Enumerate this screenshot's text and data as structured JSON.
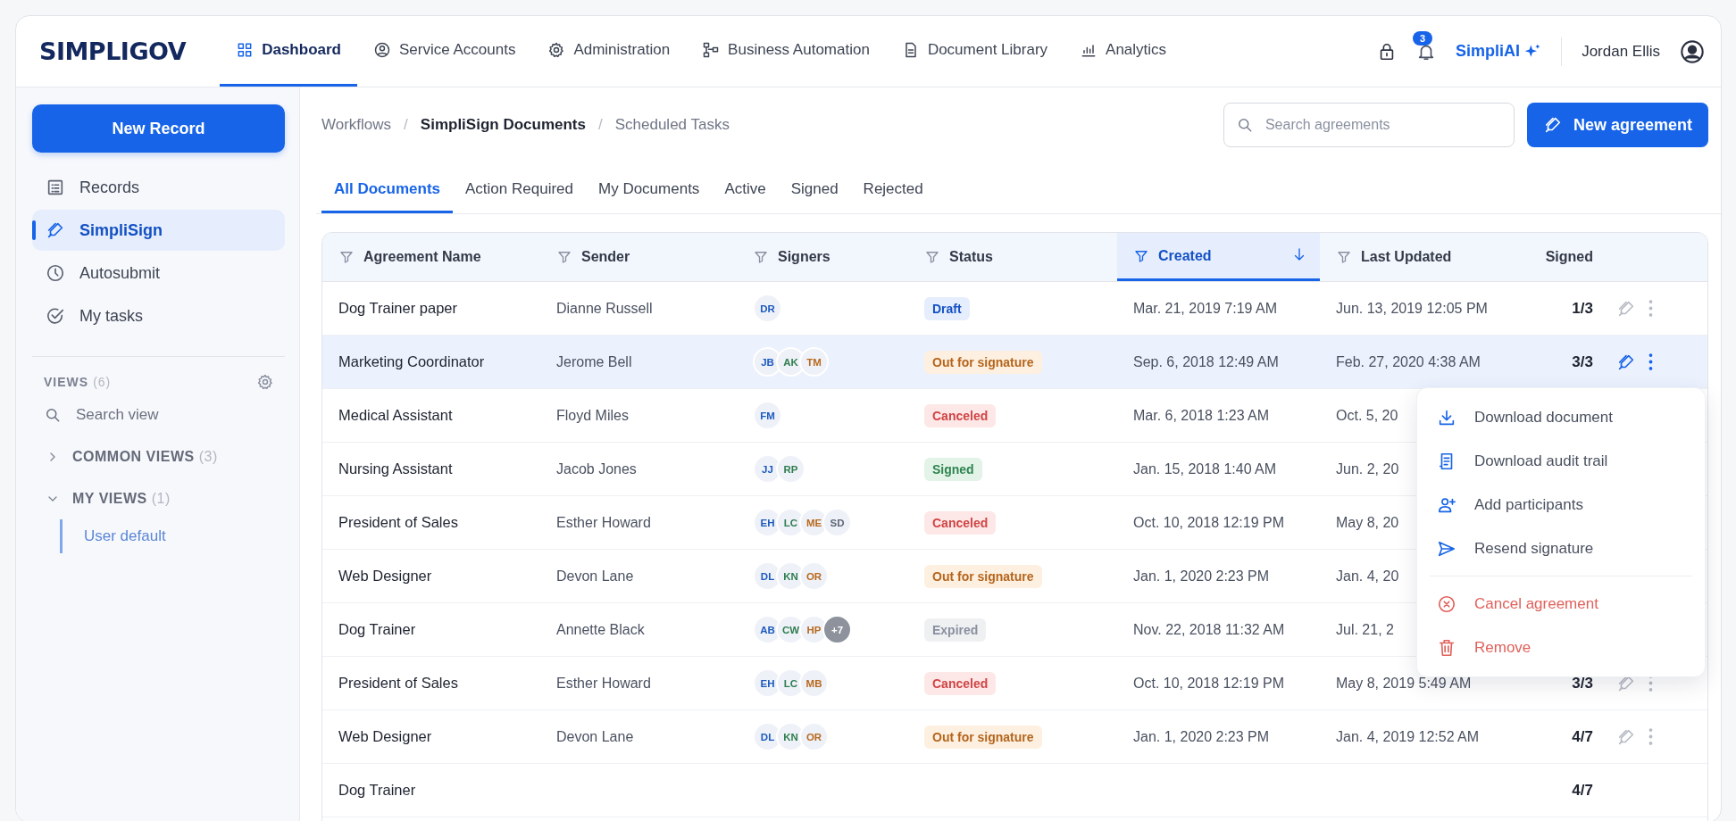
{
  "header": {
    "logo": "SIMPLIGOV",
    "nav": [
      {
        "label": "Dashboard",
        "selected": true
      },
      {
        "label": "Service Accounts",
        "selected": false
      },
      {
        "label": "Administration",
        "selected": false
      },
      {
        "label": "Business Automation",
        "selected": false
      },
      {
        "label": "Document Library",
        "selected": false
      },
      {
        "label": "Analytics",
        "selected": false
      }
    ],
    "notification_count": "3",
    "ai_label": "SimpliAI",
    "user_name": "Jordan Ellis"
  },
  "sidebar": {
    "new_button": "New Record",
    "items": [
      {
        "label": "Records",
        "selected": false
      },
      {
        "label": "SimpliSign",
        "selected": true
      },
      {
        "label": "Autosubmit",
        "selected": false
      },
      {
        "label": "My tasks",
        "selected": false
      }
    ],
    "views_title": "VIEWS",
    "views_count": "(6)",
    "search_placeholder": "Search view",
    "groups": [
      {
        "label": "COMMON VIEWS",
        "count": "(3)",
        "expanded": false
      },
      {
        "label": "MY VIEWS",
        "count": "(1)",
        "expanded": true,
        "children": [
          {
            "label": "User default"
          }
        ]
      }
    ]
  },
  "breadcrumb": {
    "separator": "/",
    "items": [
      {
        "label": "Workflows",
        "current": false
      },
      {
        "label": "SimpliSign Documents",
        "current": true
      },
      {
        "label": "Scheduled Tasks",
        "current": false
      }
    ]
  },
  "search": {
    "placeholder": "Search agreements"
  },
  "new_agreement_button": "New agreement",
  "tabs": [
    {
      "label": "All Documents",
      "selected": true
    },
    {
      "label": "Action Required",
      "selected": false
    },
    {
      "label": "My Documents",
      "selected": false
    },
    {
      "label": "Active",
      "selected": false
    },
    {
      "label": "Signed",
      "selected": false
    },
    {
      "label": "Rejected",
      "selected": false
    }
  ],
  "table": {
    "columns": [
      {
        "label": "Agreement Name",
        "filter": true,
        "sorted": false
      },
      {
        "label": "Sender",
        "filter": true,
        "sorted": false
      },
      {
        "label": "Signers",
        "filter": true,
        "sorted": false
      },
      {
        "label": "Status",
        "filter": true,
        "sorted": false
      },
      {
        "label": "Created",
        "filter": true,
        "sorted": true
      },
      {
        "label": "Last Updated",
        "filter": true,
        "sorted": false
      },
      {
        "label": "Signed",
        "filter": false,
        "sorted": false
      }
    ],
    "rows": [
      {
        "name": "Dog Trainer paper",
        "sender": "Dianne Russell",
        "signers": [
          {
            "initials": "DR",
            "color": "#1d5bbf"
          }
        ],
        "status": {
          "label": "Draft",
          "kind": "draft"
        },
        "created": "Mar. 21, 2019 7:19 AM",
        "updated": "Jun. 13, 2019 12:05 PM",
        "signed": "1/3",
        "actions": true,
        "selected": false
      },
      {
        "name": "Marketing Coordinator",
        "sender": "Jerome Bell",
        "signers": [
          {
            "initials": "JB",
            "color": "#1d5bbf"
          },
          {
            "initials": "AK",
            "color": "#2f7d4f"
          },
          {
            "initials": "TM",
            "color": "#b86a1e"
          }
        ],
        "status": {
          "label": "Out for signature",
          "kind": "pending"
        },
        "created": "Sep. 6, 2018 12:49 AM",
        "updated": "Feb. 27, 2020 4:38 AM",
        "signed": "3/3",
        "actions": true,
        "selected": true
      },
      {
        "name": "Medical Assistant",
        "sender": "Floyd Miles",
        "signers": [
          {
            "initials": "FM",
            "color": "#1d5bbf"
          }
        ],
        "status": {
          "label": "Canceled",
          "kind": "canceled"
        },
        "created": "Mar. 6, 2018 1:23 AM",
        "updated": "Oct. 5, 20",
        "actions": false,
        "selected": false
      },
      {
        "name": "Nursing Assistant",
        "sender": "Jacob Jones",
        "signers": [
          {
            "initials": "JJ",
            "color": "#1d5bbf"
          },
          {
            "initials": "RP",
            "color": "#2f7d4f"
          }
        ],
        "status": {
          "label": "Signed",
          "kind": "signed"
        },
        "created": "Jan. 15, 2018 1:40 AM",
        "updated": "Jun. 2, 20",
        "actions": false,
        "selected": false
      },
      {
        "name": "President of Sales",
        "sender": "Esther Howard",
        "signers": [
          {
            "initials": "EH",
            "color": "#1d5bbf"
          },
          {
            "initials": "LC",
            "color": "#2f7d4f"
          },
          {
            "initials": "ME",
            "color": "#b86a1e"
          },
          {
            "initials": "SD",
            "color": "#5f6675"
          }
        ],
        "status": {
          "label": "Canceled",
          "kind": "canceled"
        },
        "created": "Oct. 10, 2018 12:19 PM",
        "updated": "May 8, 20",
        "actions": false,
        "selected": false
      },
      {
        "name": "Web Designer",
        "sender": "Devon Lane",
        "signers": [
          {
            "initials": "DL",
            "color": "#1d5bbf"
          },
          {
            "initials": "KN",
            "color": "#2f7d4f"
          },
          {
            "initials": "OR",
            "color": "#b86a1e"
          }
        ],
        "status": {
          "label": "Out for signature",
          "kind": "pending"
        },
        "created": "Jan. 1, 2020 2:23 PM",
        "updated": "Jan. 4, 20",
        "actions": false,
        "selected": false
      },
      {
        "name": "Dog Trainer",
        "sender": "Annette Black",
        "signers": [
          {
            "initials": "AB",
            "color": "#1d5bbf"
          },
          {
            "initials": "CW",
            "color": "#2f7d4f"
          },
          {
            "initials": "HP",
            "color": "#b86a1e"
          }
        ],
        "more_signers": "+7",
        "status": {
          "label": "Expired",
          "kind": "expired"
        },
        "created": "Nov. 22, 2018 11:32 AM",
        "updated": "Jul. 21, 2",
        "actions": false,
        "selected": false
      },
      {
        "name": "President of Sales",
        "sender": "Esther Howard",
        "signers": [
          {
            "initials": "EH",
            "color": "#1d5bbf"
          },
          {
            "initials": "LC",
            "color": "#2f7d4f"
          },
          {
            "initials": "MB",
            "color": "#b86a1e"
          }
        ],
        "status": {
          "label": "Canceled",
          "kind": "canceled"
        },
        "created": "Oct. 10, 2018 12:19 PM",
        "updated": "May 8, 2019 5:49 AM",
        "signed": "3/3",
        "actions": true,
        "selected": false
      },
      {
        "name": "Web Designer",
        "sender": "Devon Lane",
        "signers": [
          {
            "initials": "DL",
            "color": "#1d5bbf"
          },
          {
            "initials": "KN",
            "color": "#2f7d4f"
          },
          {
            "initials": "OR",
            "color": "#b86a1e"
          }
        ],
        "status": {
          "label": "Out for signature",
          "kind": "pending"
        },
        "created": "Jan. 1, 2020 2:23 PM",
        "updated": "Jan. 4, 2019 12:52 AM",
        "signed": "4/7",
        "actions": true,
        "selected": false
      },
      {
        "name": "Dog Trainer",
        "signed": "4/7",
        "actions": false,
        "selected": false
      }
    ]
  },
  "row_menu": [
    {
      "label": "Download document",
      "kind": "action"
    },
    {
      "label": "Download audit trail",
      "kind": "action"
    },
    {
      "label": "Add participants",
      "kind": "action"
    },
    {
      "label": "Resend signature",
      "kind": "action"
    },
    {
      "label": "Cancel agreement",
      "kind": "danger"
    },
    {
      "label": "Remove",
      "kind": "danger"
    }
  ]
}
